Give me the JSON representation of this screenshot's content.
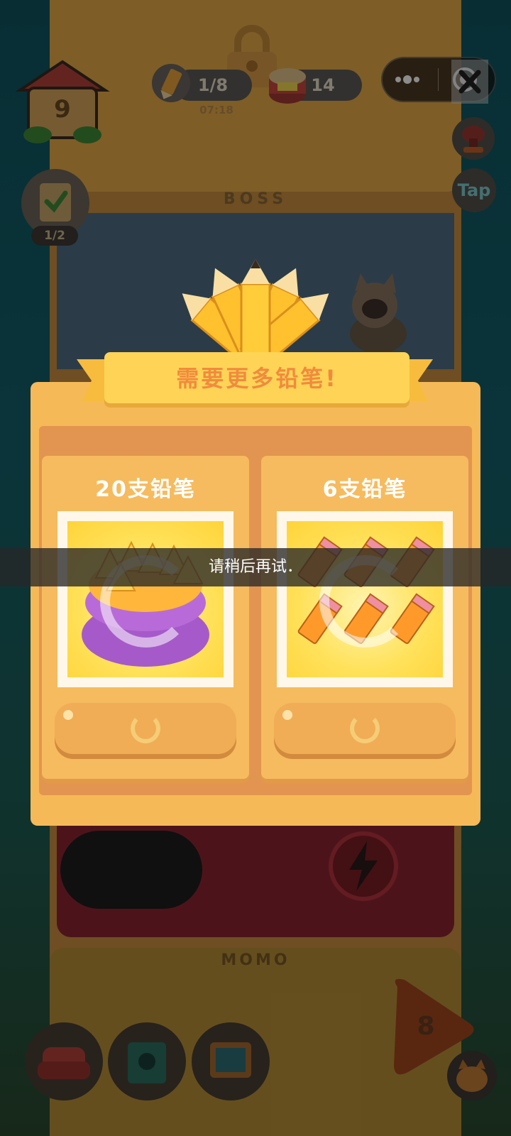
{
  "hud": {
    "house_level": "9",
    "pencils": "1/8",
    "timer": "07:18",
    "cans": "14",
    "tasks": "1/2",
    "tap_label": "Tap"
  },
  "scene": {
    "boss_sign": "BOSS",
    "momo_sign": "MOMO",
    "level_badge": "8"
  },
  "dialog": {
    "title": "需要更多铅笔!",
    "offers": [
      {
        "label": "20支铅笔"
      },
      {
        "label": "6支铅笔"
      }
    ]
  },
  "toast": {
    "message": "请稍后再试．"
  },
  "colors": {
    "accent_orange": "#f08b3d",
    "banner_yellow": "#ffd456",
    "card_bg": "#f6bb5e"
  }
}
